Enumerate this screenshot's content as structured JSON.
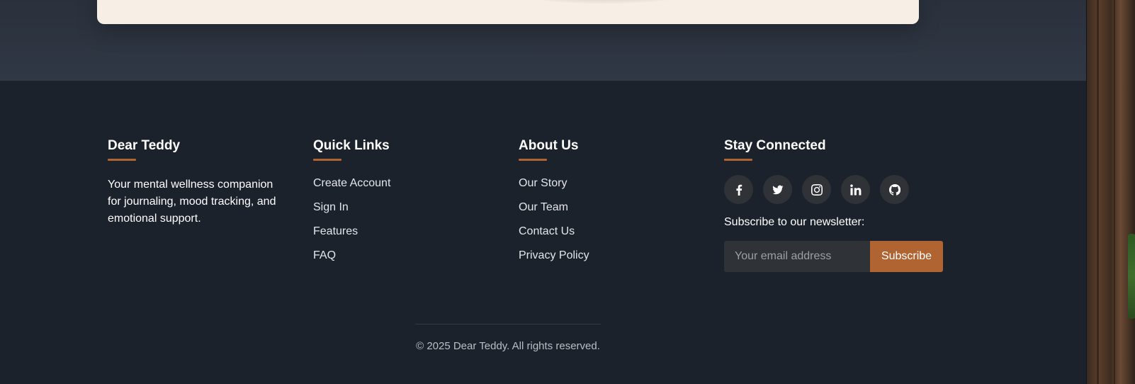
{
  "footer": {
    "brand": {
      "title": "Dear Teddy",
      "description": "Your mental wellness companion for journaling, mood tracking, and emotional support."
    },
    "quick_links": {
      "title": "Quick Links",
      "items": [
        "Create Account",
        "Sign In",
        "Features",
        "FAQ"
      ]
    },
    "about": {
      "title": "About Us",
      "items": [
        "Our Story",
        "Our Team",
        "Contact Us",
        "Privacy Policy"
      ]
    },
    "stay_connected": {
      "title": "Stay Connected",
      "social_icons": [
        "facebook-icon",
        "twitter-icon",
        "instagram-icon",
        "linkedin-icon",
        "github-icon"
      ],
      "newsletter_label": "Subscribe to our newsletter:",
      "email_placeholder": "Your email address",
      "subscribe_label": "Subscribe"
    },
    "copyright": "© 2025 Dear Teddy. All rights reserved."
  },
  "colors": {
    "accent": "#b06432",
    "footer_bg": "#1c222c",
    "card_bg": "#f7efe5"
  }
}
